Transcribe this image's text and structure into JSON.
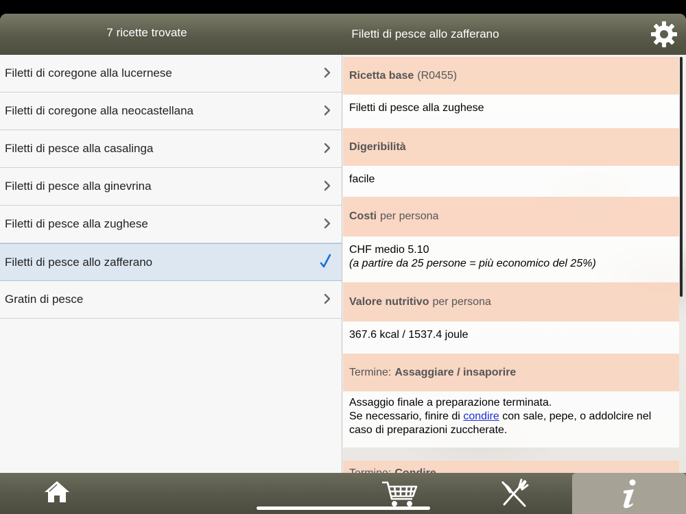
{
  "header": {
    "left_title": "7 ricette trovate",
    "right_title": "Filetti di pesce allo zafferano",
    "settings_icon": "gear-icon"
  },
  "list": {
    "items": [
      {
        "label": "Filetti di coregone alla lucernese",
        "selected": false
      },
      {
        "label": "Filetti di coregone alla neocastellana",
        "selected": false
      },
      {
        "label": "Filetti di pesce alla casalinga",
        "selected": false
      },
      {
        "label": "Filetti di pesce alla ginevrina",
        "selected": false
      },
      {
        "label": "Filetti di pesce alla zughese",
        "selected": false
      },
      {
        "label": "Filetti di pesce allo zafferano",
        "selected": true
      },
      {
        "label": "Gratin di pesce",
        "selected": false
      }
    ]
  },
  "detail": {
    "base_recipe": {
      "title": "Ricetta base",
      "suffix": "(R0455)",
      "value": "Filetti di pesce alla zughese"
    },
    "digestibility": {
      "title": "Digeribilità",
      "value": "facile"
    },
    "costs": {
      "title": "Costi",
      "suffix": "per persona",
      "value": "CHF medio 5.10",
      "note": "(a partire da 25 persone = più economico del 25%)"
    },
    "nutrition": {
      "title": "Valore nutritivo",
      "suffix": "per persona",
      "value": "367.6 kcal / 1537.4 joule"
    },
    "term1": {
      "prefix": "Termine:",
      "title": "Assaggiare / insaporire",
      "line1": "Assaggio finale a preparazione terminata.",
      "line2_before": "Se necessario, finire di ",
      "line2_link": "condire",
      "line2_after": " con sale, pepe, o addolcire nel caso di preparazioni zuccherate."
    },
    "term2": {
      "prefix": "Termine:",
      "title": "Condire"
    }
  },
  "tabbar": {
    "tabs": [
      {
        "icon": "home-icon",
        "active": false
      },
      {
        "icon": "shopping-cart-icon",
        "active": false
      },
      {
        "icon": "fork-knife-icon",
        "active": false
      },
      {
        "icon": "info-icon",
        "active": true
      }
    ]
  },
  "colors": {
    "header": "#5a5a4a",
    "section_header": "#f9d6c2",
    "selected_row": "#dce7f1",
    "check": "#1a6fd0",
    "link": "#1a2fd6"
  }
}
